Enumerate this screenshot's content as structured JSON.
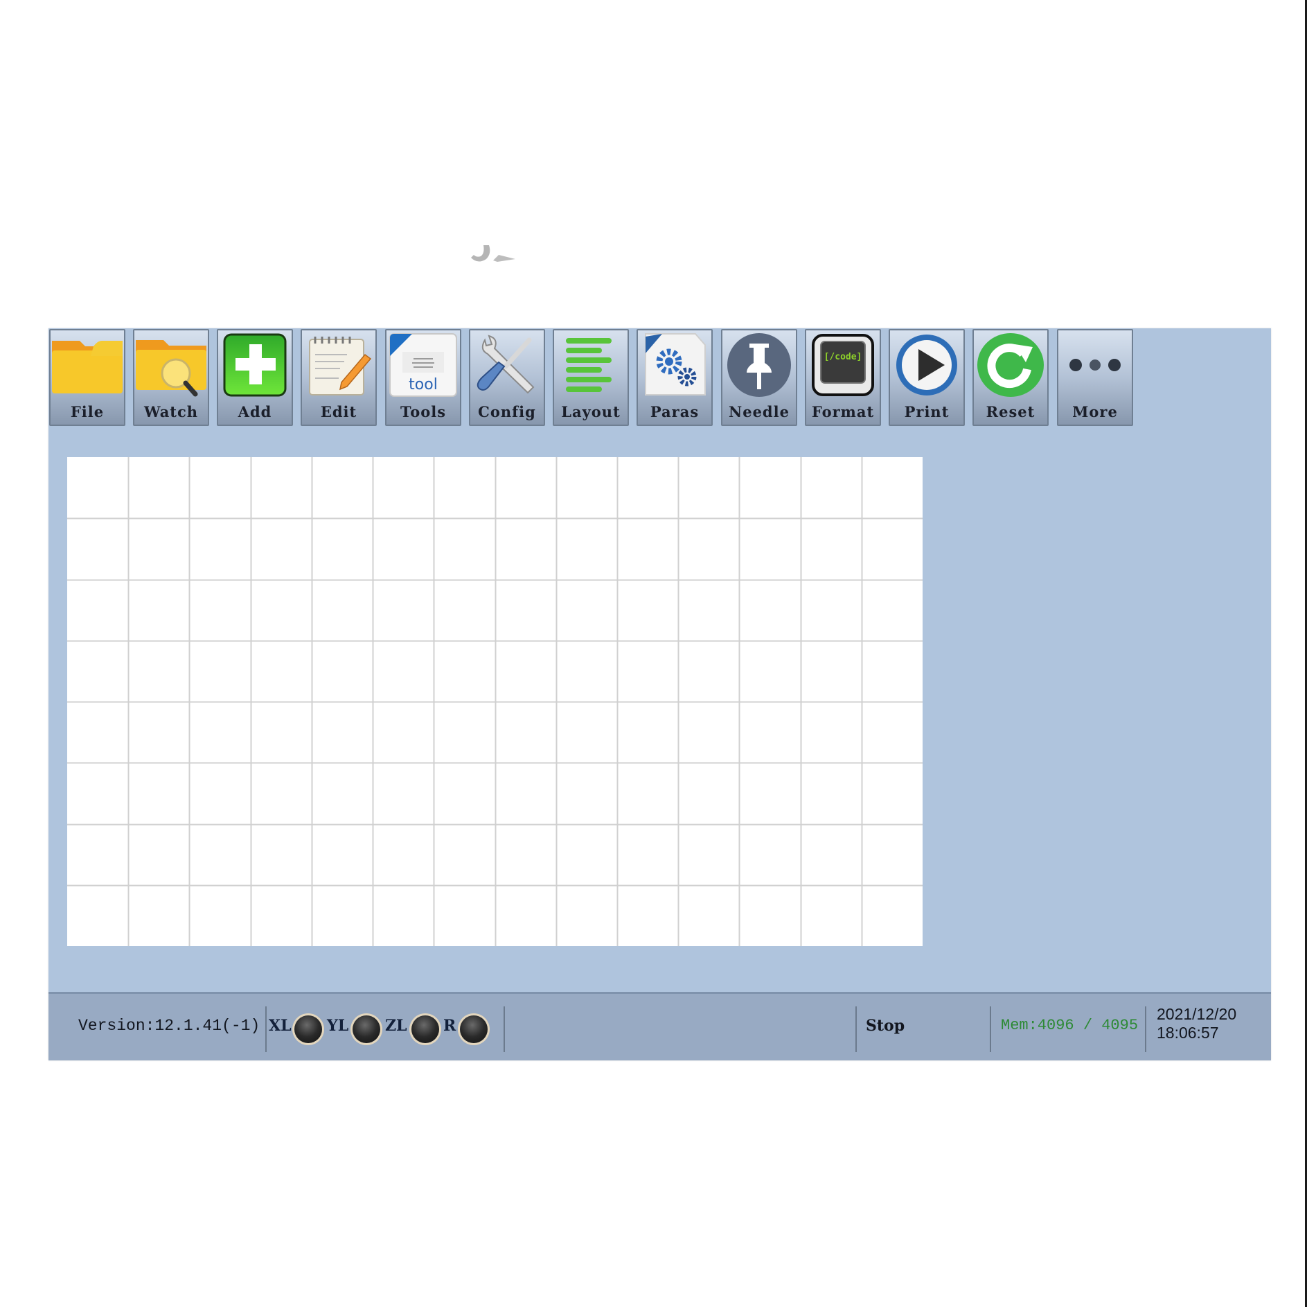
{
  "toolbar": {
    "buttons": [
      {
        "label": "File",
        "icon": "folder-icon"
      },
      {
        "label": "Watch",
        "icon": "folder-search-icon"
      },
      {
        "label": "Add",
        "icon": "plus-icon"
      },
      {
        "label": "Edit",
        "icon": "notepad-pencil-icon"
      },
      {
        "label": "Tools",
        "icon": "tool-document-icon"
      },
      {
        "label": "Config",
        "icon": "wrench-screwdriver-icon"
      },
      {
        "label": "Layout",
        "icon": "align-lines-icon"
      },
      {
        "label": "Paras",
        "icon": "gears-document-icon"
      },
      {
        "label": "Needle",
        "icon": "pushpin-icon"
      },
      {
        "label": "Format",
        "icon": "code-screen-icon"
      },
      {
        "label": "Print",
        "icon": "play-icon"
      },
      {
        "label": "Reset",
        "icon": "refresh-icon"
      },
      {
        "label": "More",
        "icon": "more-dots-icon"
      }
    ],
    "format_icon_text": "[/code]",
    "tools_icon_text": "tool"
  },
  "canvas": {
    "columns": 14,
    "rows": 8
  },
  "status": {
    "version": "Version:12.1.41(-1)",
    "leds": [
      {
        "label": "XL",
        "state": "off"
      },
      {
        "label": "YL",
        "state": "off"
      },
      {
        "label": "ZL",
        "state": "off"
      },
      {
        "label": "R",
        "state": "off"
      }
    ],
    "state": "Stop",
    "memory": "Mem:4096 / 4095",
    "date": "2021/12/20",
    "time": "18:06:57"
  },
  "colors": {
    "window_bg": "#afc4dd",
    "statusbar_bg": "#98aac3",
    "memory_text": "#2d8a35"
  }
}
